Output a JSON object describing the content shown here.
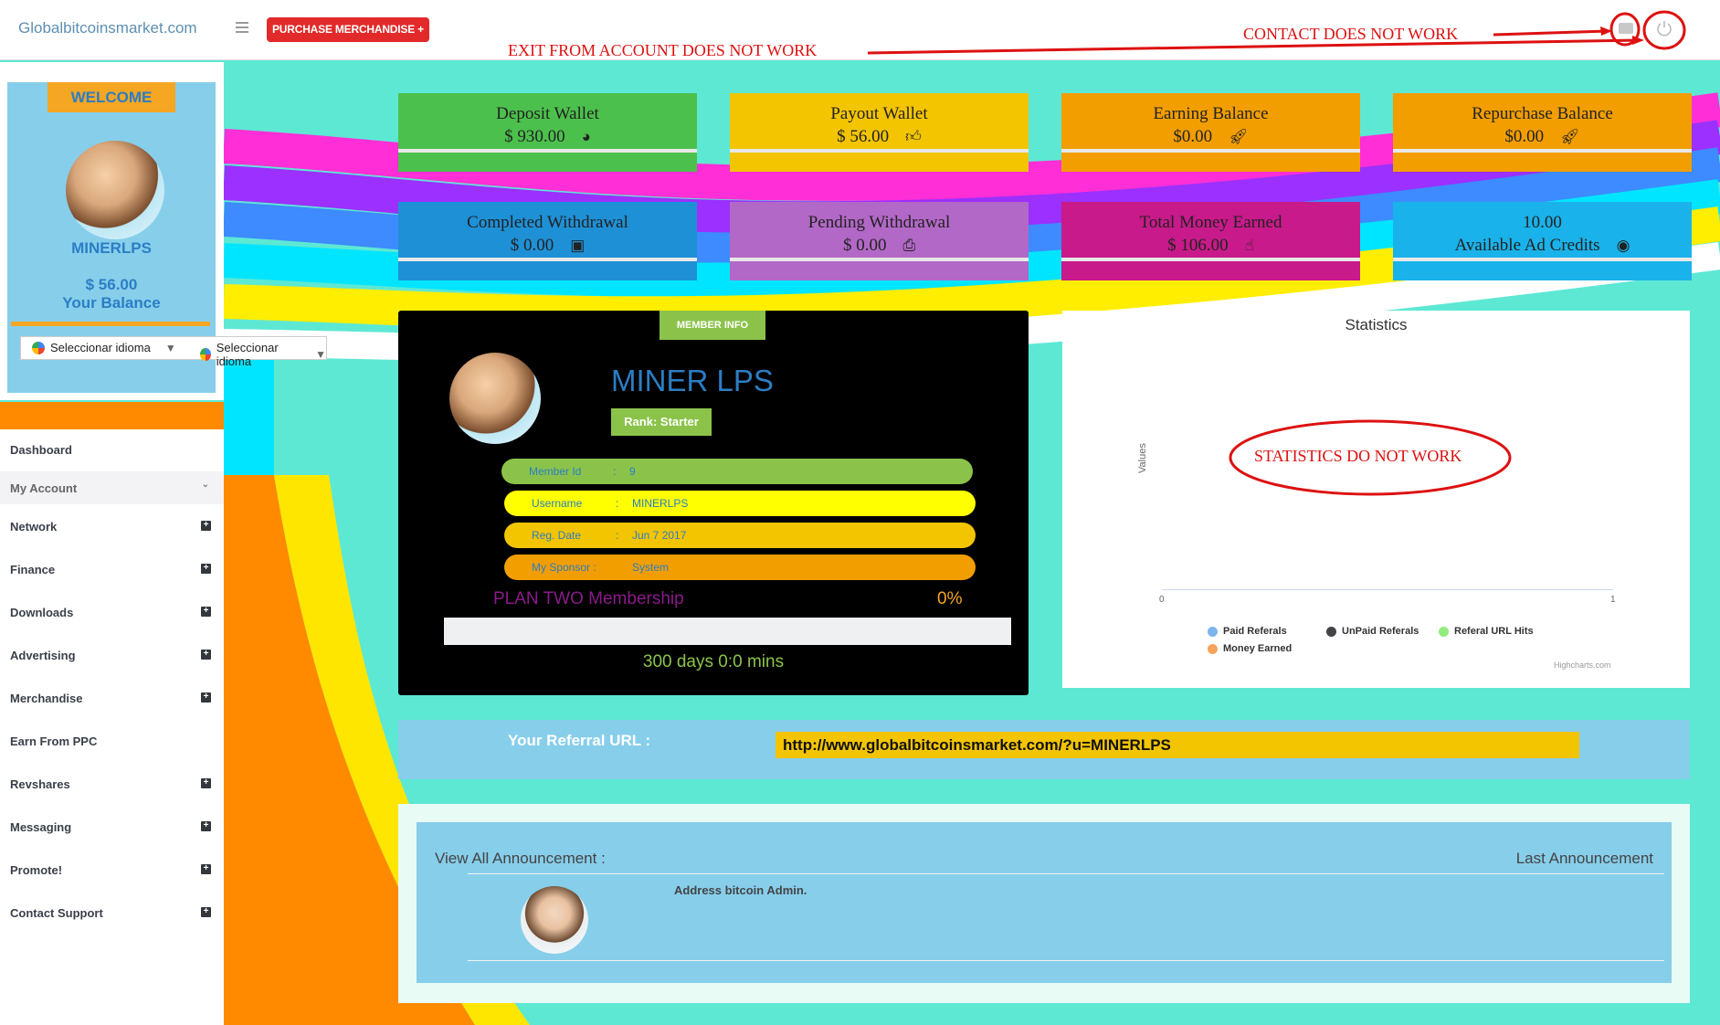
{
  "header": {
    "brand": "Globalbitcoinsmarket.com",
    "purchase_label": "PURCHASE MERCHANDISE +"
  },
  "annotations": {
    "contact": "CONTACT DOES NOT WORK",
    "exit": "EXIT FROM ACCOUNT DOES NOT WORK",
    "statistics": "STATISTICS DO NOT WORK",
    "color": "#d11111"
  },
  "sidebar": {
    "welcome": "WELCOME",
    "username": "MINERLPS",
    "balance": "$ 56.00",
    "balance_label": "Your Balance",
    "language": [
      "Seleccionar idioma",
      "Seleccionar idioma"
    ],
    "menu": [
      {
        "label": "Dashboard",
        "expandable": false,
        "active": false
      },
      {
        "label": "My Account",
        "expandable": false,
        "active": true
      },
      {
        "label": "Network",
        "expandable": true,
        "active": false
      },
      {
        "label": "Finance",
        "expandable": true,
        "active": false
      },
      {
        "label": "Downloads",
        "expandable": true,
        "active": false
      },
      {
        "label": "Advertising",
        "expandable": true,
        "active": false
      },
      {
        "label": "Merchandise",
        "expandable": true,
        "active": false
      },
      {
        "label": "Earn From PPC",
        "expandable": false,
        "active": false
      },
      {
        "label": "Revshares",
        "expandable": true,
        "active": false
      },
      {
        "label": "Messaging",
        "expandable": true,
        "active": false
      },
      {
        "label": "Promote!",
        "expandable": true,
        "active": false
      },
      {
        "label": "Contact Support",
        "expandable": true,
        "active": false
      }
    ]
  },
  "cards": [
    {
      "title": "Deposit Wallet",
      "value": "$ 930.00",
      "icon": "pie-chart-icon",
      "glyph": "◕",
      "color": "#4cc04c"
    },
    {
      "title": "Payout Wallet",
      "value": "$ 56.00",
      "icon": "thumbs-up-icon",
      "glyph": "👍︎",
      "color": "#f3c400"
    },
    {
      "title": "Earning Balance",
      "value": "$0.00",
      "icon": "rocket-icon",
      "glyph": "🚀︎",
      "color": "#f29e00"
    },
    {
      "title": "Repurchase Balance",
      "value": "$0.00",
      "icon": "rocket-icon",
      "glyph": "🚀︎",
      "color": "#f29e00"
    },
    {
      "title": "Completed Withdrawal",
      "value": "$ 0.00",
      "icon": "money-icon",
      "glyph": "▣",
      "color": "#1e90d6"
    },
    {
      "title": "Pending Withdrawal",
      "value": "$ 0.00",
      "icon": "print-icon",
      "glyph": "⎙",
      "color": "#b268c6"
    },
    {
      "title": "Total Money Earned",
      "value": "$ 106.00",
      "icon": "hand-pointer-icon",
      "glyph": "☝︎",
      "color": "#c81a8a"
    },
    {
      "title": "10.00",
      "value": "Available Ad Credits",
      "icon": "eye-icon",
      "glyph": "◉",
      "color": "#1ab2ea"
    }
  ],
  "member": {
    "tag": "MEMBER INFO",
    "name": "MINER LPS",
    "rank": "Rank: Starter",
    "fields": [
      {
        "label": "Member Id",
        "value": "9",
        "color": "#8bc34a"
      },
      {
        "label": "Username",
        "value": "MINERLPS",
        "color": "#ffff00"
      },
      {
        "label": "Reg. Date",
        "value": "Jun 7 2017",
        "color": "#f3c400"
      },
      {
        "label": "My Sponsor :",
        "value": "System",
        "color": "#f29e00"
      }
    ],
    "plan": "PLAN TWO Membership",
    "percent": "0%",
    "progress": 0,
    "days": "300 days 0:0 mins"
  },
  "statistics": {
    "title": "Statistics",
    "ylabel": "Values",
    "ticks": [
      "0",
      "1"
    ],
    "legend": [
      {
        "label": "Paid Referals",
        "color": "#7cb5ec"
      },
      {
        "label": "UnPaid Referals",
        "color": "#434348"
      },
      {
        "label": "Referal URL Hits",
        "color": "#90ed7d"
      },
      {
        "label": "Money Earned",
        "color": "#f7a35c"
      }
    ],
    "credits": "Highcharts.com"
  },
  "referral": {
    "label": "Your Referral URL :",
    "url": "http://www.globalbitcoinsmarket.com/?u=MINERLPS"
  },
  "announcement": {
    "left": "View All Announcement :",
    "right": "Last Announcement",
    "text": "Address bitcoin Admin."
  }
}
